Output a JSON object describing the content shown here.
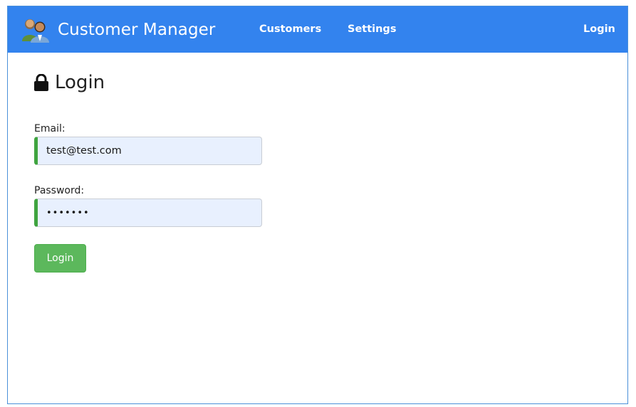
{
  "navbar": {
    "brand_title": "Customer Manager",
    "logo_icon": "people-icon",
    "links": {
      "customers": "Customers",
      "settings": "Settings",
      "login": "Login"
    },
    "background_color": "#3383ee"
  },
  "main": {
    "title": "Login",
    "title_icon": "lock-icon",
    "form": {
      "email_label": "Email:",
      "email_value": "test@test.com",
      "password_label": "Password:",
      "password_value": "•••••••",
      "submit_label": "Login",
      "submit_color": "#5cb85c",
      "valid_indicator_color": "#3fa43f"
    }
  }
}
